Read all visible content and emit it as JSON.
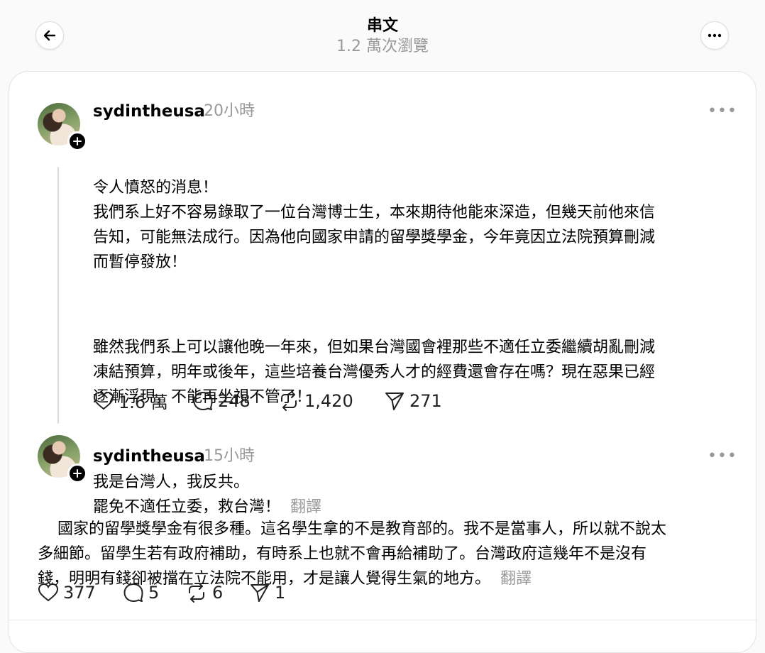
{
  "header": {
    "title": "串文",
    "views": "1.2 萬次瀏覽"
  },
  "posts": [
    {
      "username": "sydintheusa",
      "time": "20小時",
      "paragraphs": [
        "令人憤怒的消息！\n我們系上好不容易錄取了一位台灣博士生，本來期待他能來深造，但幾天前他來信\n告知，可能無法成行。因為他向國家申請的留學獎學金，今年竟因立法院預算刪減\n而暫停發放！",
        "雖然我們系上可以讓他晚一年來，但如果台灣國會裡那些不適任立委繼續胡亂刪減\n凍結預算，明年或後年，這些培養台灣優秀人才的經費還會存在嗎？現在惡果已經\n逐漸浮現，不能再坐視不管了！",
        "我是台灣人，我反共。\n罷免不適任立委，救台灣！"
      ],
      "translate": "翻譯",
      "likes": "1.6 萬",
      "comments": "248",
      "reposts": "1,420",
      "shares": "271"
    },
    {
      "username": "sydintheusa",
      "time": "15小時",
      "text": "國家的留學獎學金有很多種。這名學生拿的不是教育部的。我不是當事人，所以就不說太\n多細節。留學生若有政府補助，有時系上也就不會再給補助了。台灣政府這幾年不是沒有\n錢，明明有錢卻被擋在立法院不能用，才是讓人覺得生氣的地方。",
      "translate": "翻譯",
      "likes": "377",
      "comments": "5",
      "reposts": "6",
      "shares": "1"
    }
  ],
  "icons": {
    "back": "arrow-left-icon",
    "more": "more-dots-icon",
    "like": "heart-icon",
    "comment": "comment-bubble-icon",
    "repost": "repost-icon",
    "share": "send-icon",
    "follow": "plus-icon"
  },
  "colors": {
    "background": "#fafafa",
    "card": "#ffffff",
    "muted_text": "#999999"
  }
}
